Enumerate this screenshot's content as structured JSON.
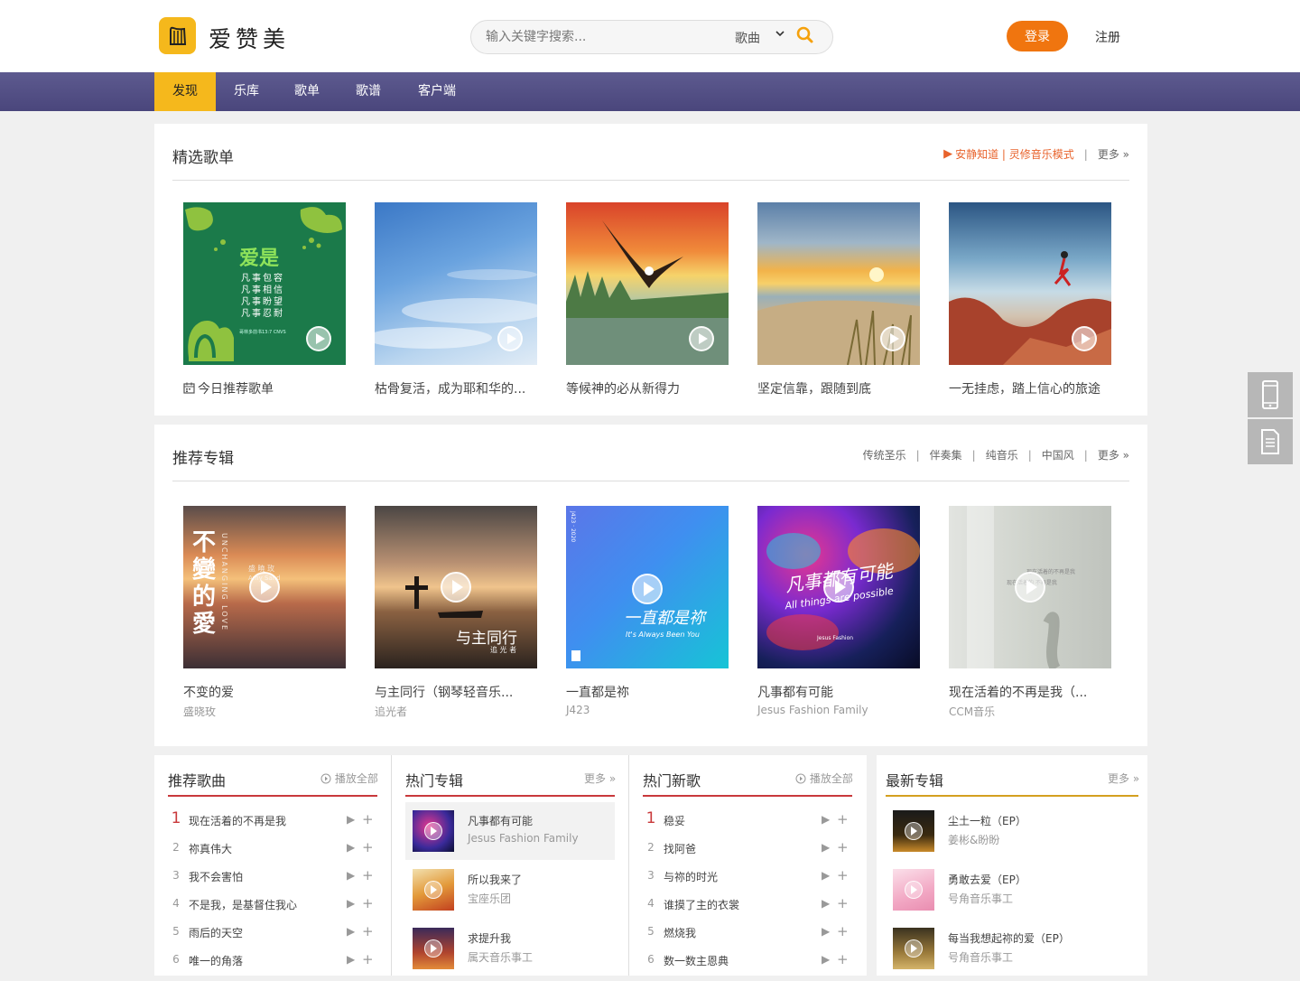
{
  "header": {
    "logo_text": "爱赞美",
    "search_placeholder": "输入关键字搜索...",
    "search_type": "歌曲",
    "login": "登录",
    "register": "注册"
  },
  "nav": {
    "items": [
      {
        "label": "发现",
        "active": true
      },
      {
        "label": "乐库"
      },
      {
        "label": "歌单"
      },
      {
        "label": "歌谱"
      },
      {
        "label": "客户端"
      }
    ]
  },
  "featured": {
    "title": "精选歌单",
    "mode_link": "安静知道 | 灵修音乐模式",
    "more": "更多 »",
    "cover1_text": {
      "big": "爱是",
      "lines": [
        "凡事包容",
        "凡事相信",
        "凡事盼望",
        "凡事忍耐"
      ],
      "ref": "哥林多前书13:7 CNVS"
    },
    "cards": [
      {
        "title": "今日推荐歌单"
      },
      {
        "title": "枯骨复活，成为耶和华的..."
      },
      {
        "title": "等候神的必从新得力"
      },
      {
        "title": "坚定信靠，跟随到底"
      },
      {
        "title": "一无挂虑，踏上信心的旅途"
      }
    ]
  },
  "albums": {
    "title": "推荐专辑",
    "links": [
      "传统圣乐",
      "伴奏集",
      "纯音乐",
      "中国风",
      "更多 »"
    ],
    "cover_text": {
      "a1": "不變的愛",
      "a1_en": "UNCHANGING LOVE",
      "a1_artist": "盛 曉 玫",
      "a1_artist_en": "Amy Sand",
      "a2": "与主同行",
      "a2_artist": "追 光 者",
      "a3": "一直都是祢",
      "a3_en": "It's Always Been You",
      "a3_side": "J423 · 2020",
      "a4": "凡事都有可能",
      "a4_en": "All things are possible",
      "a4_brand": "Jesus Fashion",
      "a5": "现在活着的不再是我",
      "a5_sub": "现在活着的 不再是我"
    },
    "cards": [
      {
        "title": "不变的爱",
        "artist": "盛晓玫"
      },
      {
        "title": "与主同行（钢琴轻音乐...",
        "artist": "追光者"
      },
      {
        "title": "一直都是祢",
        "artist": "J423"
      },
      {
        "title": "凡事都有可能",
        "artist": "Jesus Fashion Family"
      },
      {
        "title": "现在活着的不再是我（...",
        "artist": "CCM音乐"
      }
    ]
  },
  "recommended_songs": {
    "title": "推荐歌曲",
    "action": "播放全部",
    "songs": [
      {
        "n": "1",
        "name": "现在活着的不再是我"
      },
      {
        "n": "2",
        "name": "祢真伟大"
      },
      {
        "n": "3",
        "name": "我不会害怕"
      },
      {
        "n": "4",
        "name": "不是我，是基督住我心"
      },
      {
        "n": "5",
        "name": "雨后的天空"
      },
      {
        "n": "6",
        "name": "唯一的角落"
      }
    ]
  },
  "hot_albums": {
    "title": "热门专辑",
    "action": "更多 »",
    "items": [
      {
        "name": "凡事都有可能",
        "artist": "Jesus Fashion Family"
      },
      {
        "name": "所以我来了",
        "artist": "宝座乐团"
      },
      {
        "name": "求提升我",
        "artist": "属天音乐事工"
      }
    ]
  },
  "hot_new_songs": {
    "title": "热门新歌",
    "action": "播放全部",
    "songs": [
      {
        "n": "1",
        "name": "稳妥"
      },
      {
        "n": "2",
        "name": "找阿爸"
      },
      {
        "n": "3",
        "name": "与祢的时光"
      },
      {
        "n": "4",
        "name": "谁摸了主的衣裳"
      },
      {
        "n": "5",
        "name": "燃烧我"
      },
      {
        "n": "6",
        "name": "数一数主恩典"
      }
    ]
  },
  "latest_albums": {
    "title": "最新专辑",
    "action": "更多 »",
    "items": [
      {
        "name": "尘土一粒（EP）",
        "artist": "姜彬&盼盼"
      },
      {
        "name": "勇敢去爱（EP）",
        "artist": "号角音乐事工"
      },
      {
        "name": "每当我想起祢的爱（EP）",
        "artist": "号角音乐事工"
      }
    ]
  },
  "colors": {
    "accent": "#f0750f",
    "nav": "#4f4b82",
    "active_tab": "#f5b81c",
    "red_line": "#c9393b",
    "gold_line": "#d4a020"
  }
}
